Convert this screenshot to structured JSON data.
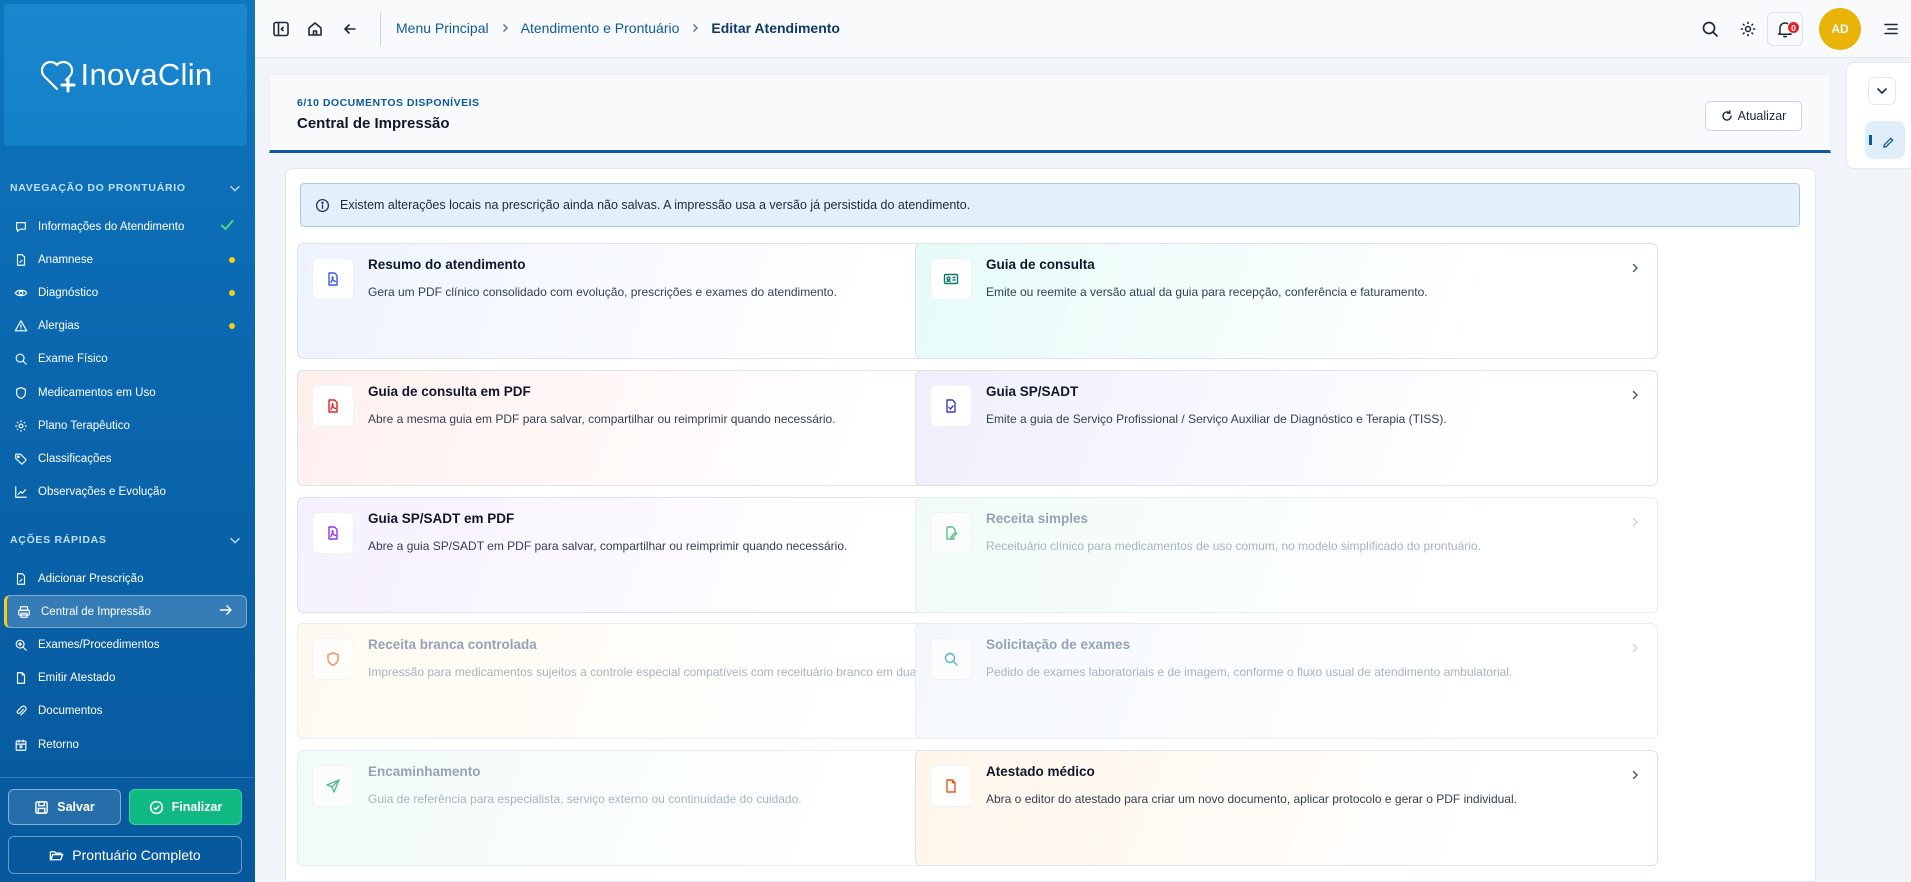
{
  "brand": {
    "name": "InovaClin"
  },
  "sidebar": {
    "nav_section_title": "NAVEGAÇÃO DO PRONTUÁRIO",
    "nav_items": [
      {
        "label": "Informações do Atendimento",
        "icon": "chat-bubble-icon",
        "status": "complete"
      },
      {
        "label": "Anamnese",
        "icon": "document-edit-icon",
        "status": "pending"
      },
      {
        "label": "Diagnóstico",
        "icon": "eye-icon",
        "status": "pending"
      },
      {
        "label": "Alergias",
        "icon": "warning-triangle-icon",
        "status": "pending"
      },
      {
        "label": "Exame Físico",
        "icon": "search-icon",
        "status": ""
      },
      {
        "label": "Medicamentos em Uso",
        "icon": "shield-icon",
        "status": ""
      },
      {
        "label": "Plano Terapêutico",
        "icon": "gear-icon",
        "status": ""
      },
      {
        "label": "Classificações",
        "icon": "tag-icon",
        "status": ""
      },
      {
        "label": "Observações e Evolução",
        "icon": "chart-line-icon",
        "status": ""
      }
    ],
    "quick_section_title": "AÇÕES RÁPIDAS",
    "quick_items": [
      {
        "label": "Adicionar Prescrição",
        "icon": "document-edit-icon",
        "active": false
      },
      {
        "label": "Central de Impressão",
        "icon": "printer-icon",
        "active": true
      },
      {
        "label": "Exames/Procedimentos",
        "icon": "search-plus-icon",
        "active": false
      },
      {
        "label": "Emitir Atestado",
        "icon": "document-icon",
        "active": false
      },
      {
        "label": "Documentos",
        "icon": "paperclip-icon",
        "active": false
      },
      {
        "label": "Retorno",
        "icon": "calendar-icon",
        "active": false
      }
    ],
    "save_label": "Salvar",
    "finish_label": "Finalizar",
    "full_record_label": "Prontuário Completo"
  },
  "topbar": {
    "breadcrumbs": [
      "Menu Principal",
      "Atendimento e Prontuário",
      "Editar Atendimento"
    ],
    "notification_count": "0",
    "avatar_initials": "AD"
  },
  "header": {
    "eyebrow": "6/10 DOCUMENTOS DISPONÍVEIS",
    "title": "Central de Impressão",
    "refresh_label": "Atualizar"
  },
  "alert": {
    "text": "Existem alterações locais na prescrição ainda não salvas. A impressão usa a versão já persistida do atendimento."
  },
  "cards": [
    {
      "title": "Resumo do atendimento",
      "description": "Gera um PDF clínico consolidado com evolução, prescrições e exames do atendimento.",
      "icon": "file-pdf-icon",
      "icon_color": "#3b5bd6",
      "tint": "#eef3ff",
      "enabled": true
    },
    {
      "title": "Guia de consulta",
      "description": "Emite ou reemite a versão atual da guia para recepção, conferência e faturamento.",
      "icon": "id-card-icon",
      "icon_color": "#0f766e",
      "tint": "#e6fbf8",
      "enabled": true
    },
    {
      "title": "Guia de consulta em PDF",
      "description": "Abre a mesma guia em PDF para salvar, compartilhar ou reimprimir quando necessário.",
      "icon": "file-pdf-icon",
      "icon_color": "#dc2626",
      "tint": "#fff0ee",
      "enabled": true
    },
    {
      "title": "Guia SP/SADT",
      "description": "Emite a guia de Serviço Profissional / Serviço Auxiliar de Diagnóstico e Terapia (TISS).",
      "icon": "file-check-icon",
      "icon_color": "#3b3fb6",
      "tint": "#eeeffc",
      "enabled": true
    },
    {
      "title": "Guia SP/SADT em PDF",
      "description": "Abre a guia SP/SADT em PDF para salvar, compartilhar ou reimprimir quando necessário.",
      "icon": "file-pdf-icon",
      "icon_color": "#9333ea",
      "tint": "#f5f0fe",
      "enabled": true
    },
    {
      "title": "Receita simples",
      "description": "Receituário clínico para medicamentos de uso comum, no modelo simplificado do prontuário.",
      "icon": "file-edit-icon",
      "icon_color": "#16a34a",
      "tint": "#f1fbf5",
      "enabled": false
    },
    {
      "title": "Receita branca controlada",
      "description": "Impressão para medicamentos sujeitos a controle especial compatíveis com receituário branco em duas vias.",
      "icon": "shield-icon",
      "icon_color": "#ea580c",
      "tint": "#fffaf0",
      "enabled": false
    },
    {
      "title": "Solicitação de exames",
      "description": "Pedido de exames laboratoriais e de imagem, conforme o fluxo usual de atendimento ambulatorial.",
      "icon": "search-icon",
      "icon_color": "#0284c7",
      "tint": "#f4f8fd",
      "enabled": false
    },
    {
      "title": "Encaminhamento",
      "description": "Guia de referência para especialista, serviço externo ou continuidade do cuidado.",
      "icon": "send-icon",
      "icon_color": "#059669",
      "tint": "#f1fbf7",
      "enabled": false
    },
    {
      "title": "Atestado médico",
      "description": "Abra o editor do atestado para criar um novo documento, aplicar protocolo e gerar o PDF individual.",
      "icon": "file-icon",
      "icon_color": "#ea580c",
      "tint": "#fff5ea",
      "enabled": true
    }
  ],
  "colors": {
    "sidebar_blue": "#0a66ad",
    "accent_yellow": "#facc15",
    "finish_green": "#10b981",
    "breadcrumb_blue": "#0e5a9a",
    "avatar_yellow": "#eab308",
    "badge_red": "#dc2626"
  }
}
